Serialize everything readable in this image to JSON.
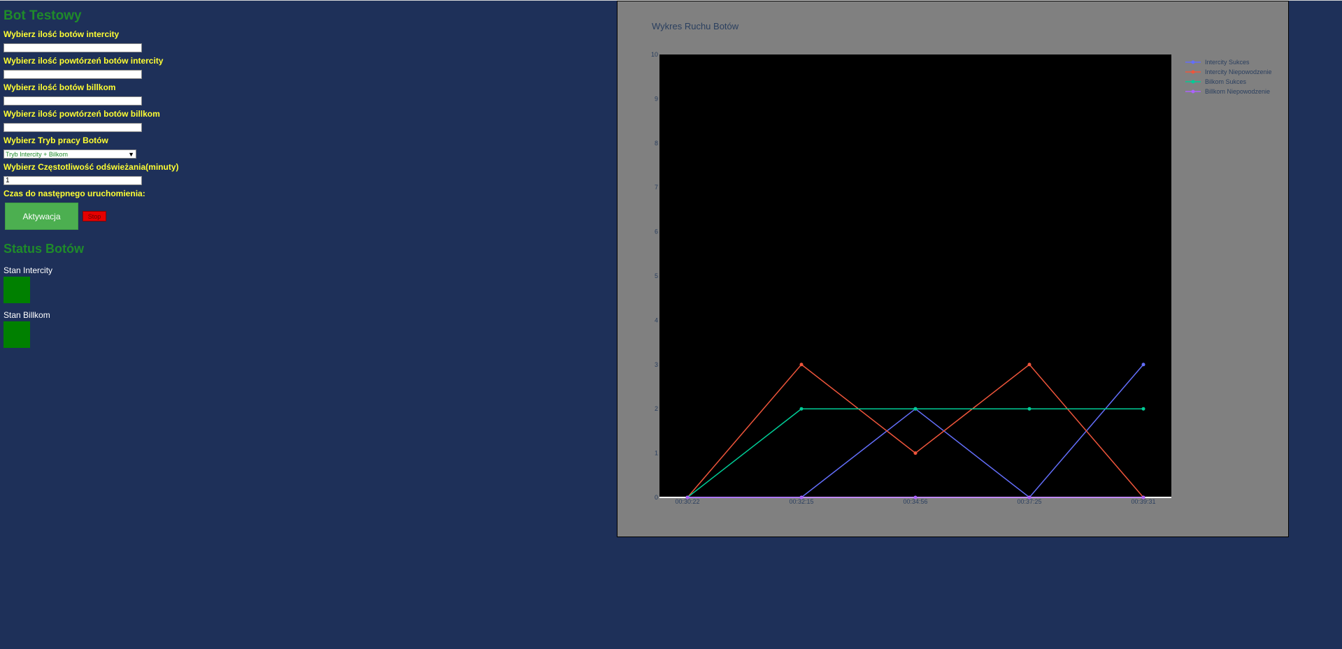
{
  "header": {
    "title": "Bot Testowy"
  },
  "form": {
    "intercity_count_label": "Wybierz ilość botów intercity",
    "intercity_count_value": "",
    "intercity_repeat_label": "Wybierz ilość powtórzeń botów intercity",
    "intercity_repeat_value": "",
    "billkom_count_label": "Wybierz ilość botów billkom",
    "billkom_count_value": "",
    "billkom_repeat_label": "Wybierz ilość powtórzeń botów billkom",
    "billkom_repeat_value": "",
    "mode_label": "Wybierz Tryb pracy Botów",
    "mode_selected": "Tryb Intercity + Bilkom",
    "refresh_label": "Wybierz Częstotliwość odświeżania(minuty)",
    "refresh_value": "1",
    "countdown_label": "Czas do następnego uruchomienia:",
    "activate_label": "Aktywacja",
    "stop_label": "Stop"
  },
  "status": {
    "title": "Status Botów",
    "intercity_label": "Stan Intercity",
    "intercity_color": "#008000",
    "billkom_label": "Stan Billkom",
    "billkom_color": "#008000"
  },
  "chart_data": {
    "type": "line",
    "title": "Wykres Ruchu Botów",
    "x": [
      "00:30:22",
      "00:32:15",
      "00:34:56",
      "00:37:25",
      "00:39:31"
    ],
    "ylim": [
      0,
      10
    ],
    "yticks": [
      0,
      1,
      2,
      3,
      4,
      5,
      6,
      7,
      8,
      9,
      10
    ],
    "grid": false,
    "legend_position": "top-right",
    "series": [
      {
        "name": "Intercity Sukces",
        "color": "#636efa",
        "values": [
          0,
          0,
          2,
          0,
          3
        ]
      },
      {
        "name": "Intercity Niepowodzenie",
        "color": "#ef553b",
        "values": [
          0,
          3,
          1,
          3,
          0
        ]
      },
      {
        "name": "Bilkom Sukces",
        "color": "#00cc96",
        "values": [
          0,
          2,
          2,
          2,
          2
        ]
      },
      {
        "name": "Billkom Niepowodzenie",
        "color": "#ab63fa",
        "values": [
          0,
          0,
          0,
          0,
          0
        ]
      }
    ]
  }
}
